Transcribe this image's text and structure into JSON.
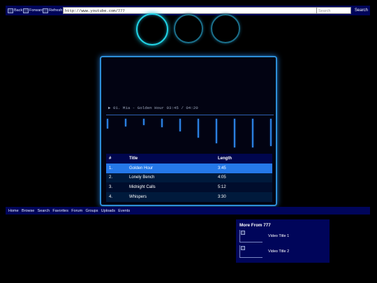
{
  "browser": {
    "back_label": "Back",
    "forward_label": "Forward",
    "refresh_label": "Refresh",
    "url": "http://www.youtube.com/777",
    "search_placeholder": "Search",
    "search_button": "Search"
  },
  "player": {
    "now_playing": "▶ 01. Mia - Golden Hour  03:45 / 04:20",
    "visualizer_levels": [
      0.45,
      0.35,
      0.3,
      0.4,
      0.6,
      0.9,
      1.15,
      1.35,
      1.35,
      1.3
    ],
    "columns": [
      "#",
      "Title",
      "Length"
    ],
    "tracks": [
      {
        "num": "1.",
        "title": "Golden Hour",
        "length": "3:45"
      },
      {
        "num": "2.",
        "title": "Lonely Bench",
        "length": "4:05"
      },
      {
        "num": "3.",
        "title": "Midnight Calls",
        "length": "5:12"
      },
      {
        "num": "4.",
        "title": "Whispers",
        "length": "3:30"
      }
    ]
  },
  "nav": {
    "items": [
      "Home",
      "Browse",
      "Search",
      "Favorites",
      "Forum",
      "Groups",
      "Uploads",
      "Events"
    ]
  },
  "more": {
    "title": "More From 777",
    "videos": [
      "Video Title 1",
      "Video Title 2"
    ]
  },
  "colors": {
    "accent": "#2578e8",
    "ring": "#21d5e6",
    "bar_bg": "#00055a"
  }
}
